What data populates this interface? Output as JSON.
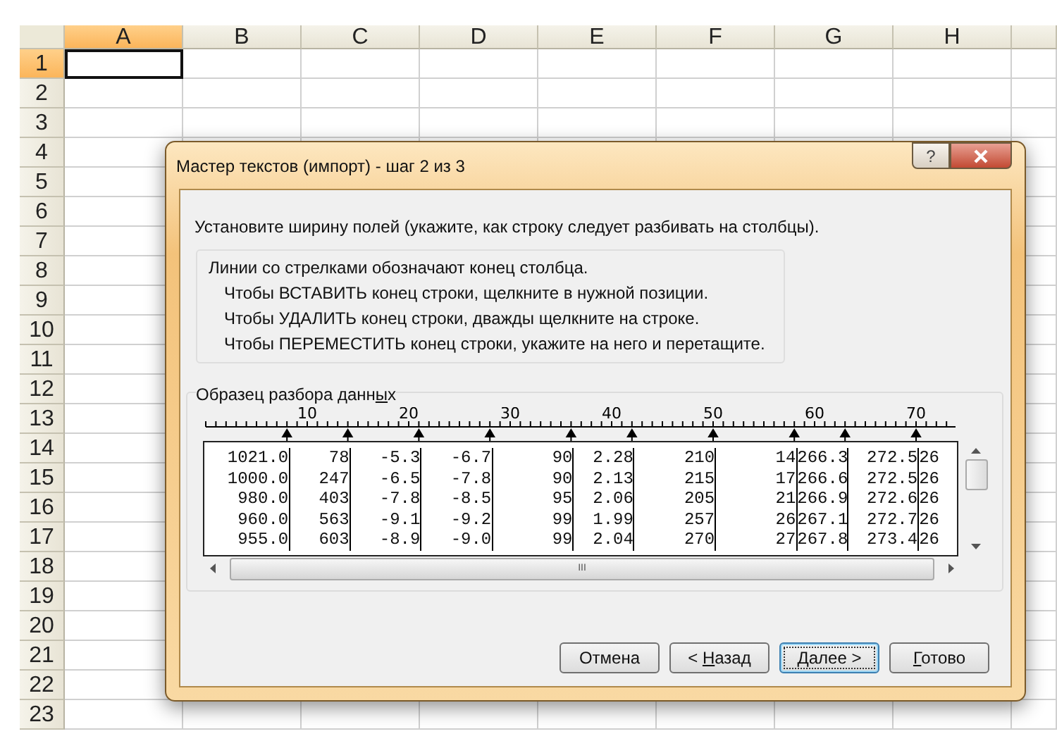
{
  "sheet": {
    "columns": [
      {
        "label": "A",
        "selected": true
      },
      {
        "label": "B",
        "selected": false
      },
      {
        "label": "C",
        "selected": false
      },
      {
        "label": "D",
        "selected": false
      },
      {
        "label": "E",
        "selected": false
      },
      {
        "label": "F",
        "selected": false
      },
      {
        "label": "G",
        "selected": false
      },
      {
        "label": "H",
        "selected": false
      }
    ],
    "rows": [
      {
        "label": "1",
        "selected": true
      },
      {
        "label": "2",
        "selected": false
      },
      {
        "label": "3",
        "selected": false
      },
      {
        "label": "4",
        "selected": false
      },
      {
        "label": "5",
        "selected": false
      },
      {
        "label": "6",
        "selected": false
      },
      {
        "label": "7",
        "selected": false
      },
      {
        "label": "8",
        "selected": false
      },
      {
        "label": "9",
        "selected": false
      },
      {
        "label": "10",
        "selected": false
      },
      {
        "label": "11",
        "selected": false
      },
      {
        "label": "12",
        "selected": false
      },
      {
        "label": "13",
        "selected": false
      },
      {
        "label": "14",
        "selected": false
      },
      {
        "label": "15",
        "selected": false
      },
      {
        "label": "16",
        "selected": false
      },
      {
        "label": "17",
        "selected": false
      },
      {
        "label": "18",
        "selected": false
      },
      {
        "label": "19",
        "selected": false
      },
      {
        "label": "20",
        "selected": false
      },
      {
        "label": "21",
        "selected": false
      },
      {
        "label": "22",
        "selected": false
      },
      {
        "label": "23",
        "selected": false
      }
    ]
  },
  "dialog": {
    "title": "Мастер текстов (импорт) - шаг 2 из 3",
    "help_button": "?",
    "instruction": "Установите ширину полей (укажите, как строку следует разбивать на столбцы).",
    "info": {
      "heading": "Линии со стрелками обозначают конец столбца.",
      "lines": [
        "Чтобы ВСТАВИТЬ конец строки, щелкните в нужной позиции.",
        "Чтобы УДАЛИТЬ конец строки, дважды щелкните на строке.",
        "Чтобы ПЕРЕМЕСТИТЬ конец строки, укажите на него и перетащите."
      ]
    },
    "preview": {
      "label": {
        "before": "Образец разбора дан",
        "accel": "ы",
        "after": "х",
        "accel_pre": "н"
      },
      "ruler": [
        "10",
        "20",
        "30",
        "40",
        "50",
        "60",
        "70"
      ],
      "rows": [
        [
          "1021.0",
          "78",
          "-5.3",
          "-6.7",
          "90",
          "2.28",
          "210",
          "14",
          "266.3",
          "272.5",
          "26"
        ],
        [
          "1000.0",
          "247",
          "-6.5",
          "-7.8",
          "90",
          "2.13",
          "215",
          "17",
          "266.6",
          "272.5",
          "26"
        ],
        [
          "980.0",
          "403",
          "-7.8",
          "-8.5",
          "95",
          "2.06",
          "205",
          "21",
          "266.9",
          "272.6",
          "26"
        ],
        [
          "960.0",
          "563",
          "-9.1",
          "-9.2",
          "99",
          "1.99",
          "257",
          "26",
          "267.1",
          "272.7",
          "26"
        ],
        [
          "955.0",
          "603",
          "-8.9",
          "-9.0",
          "99",
          "2.04",
          "270",
          "27",
          "267.8",
          "273.4",
          "26"
        ]
      ],
      "scrollbar_grip": "III"
    },
    "buttons": [
      {
        "before": "Отмена",
        "focused": false
      },
      {
        "before": "< ",
        "accel": "Н",
        "after": "азад",
        "focused": false
      },
      {
        "accel": "Д",
        "after": "алее >",
        "focused": true
      },
      {
        "accel": "Г",
        "after": "отово",
        "focused": false
      }
    ]
  }
}
